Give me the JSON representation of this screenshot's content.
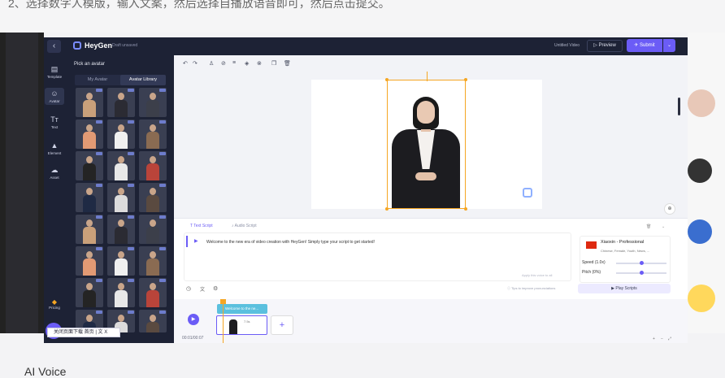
{
  "background": {
    "top_text": "2、选择数字人模版，输入文案，然后选择自播放语音即可，然后点击提交。",
    "bottom_text": "AI Voice"
  },
  "header": {
    "logo": "HeyGen",
    "draft_status": "Draft unsaved",
    "video_title": "Untitled Video",
    "preview_label": "Preview",
    "submit_label": "Submit"
  },
  "nav": [
    {
      "label": "Template",
      "icon": "template-icon"
    },
    {
      "label": "Avatar",
      "icon": "avatar-icon"
    },
    {
      "label": "Text",
      "icon": "text-icon"
    },
    {
      "label": "Element",
      "icon": "element-icon"
    },
    {
      "label": "Asset",
      "icon": "asset-icon"
    }
  ],
  "pricing_label": "Pricing",
  "panel": {
    "title": "Pick an avatar",
    "tabs": [
      "My Avatar",
      "Avatar Library"
    ]
  },
  "thumb_badge": "HD",
  "toolbar_icons": [
    "undo-icon",
    "redo-icon",
    "person-icon",
    "link-icon",
    "align-icon",
    "layers-icon",
    "hide-icon",
    "copy-icon",
    "delete-icon"
  ],
  "script": {
    "tab_text": "Text Script",
    "tab_audio": "Audio Script",
    "text": "Welcome to the new era of video creation with HeyGen! Simply type your script to get started!",
    "apply_text": "Apply this voice to all",
    "tips": "Tips to improve pronunciations",
    "play_label": "Play Scripts"
  },
  "voice": {
    "name": "Xiaoxin - Professional",
    "tags": "Chinese, Female, Youth, News, ...",
    "speed_label": "Speed (1.0x)",
    "pitch_label": "Pitch (0%)",
    "speed_value": 0.5,
    "pitch_value": 0.5
  },
  "timeline": {
    "clip_label": "Welcome to the ne...",
    "clip_time": "7.5s",
    "time": "00:01/00:07",
    "add_label": "+"
  },
  "float_chip": "关闭页面下载 首页 | 文 X",
  "colors": {
    "accent": "#6b5cf6",
    "selection": "#f5a623",
    "sidebar": "#1d2235"
  }
}
